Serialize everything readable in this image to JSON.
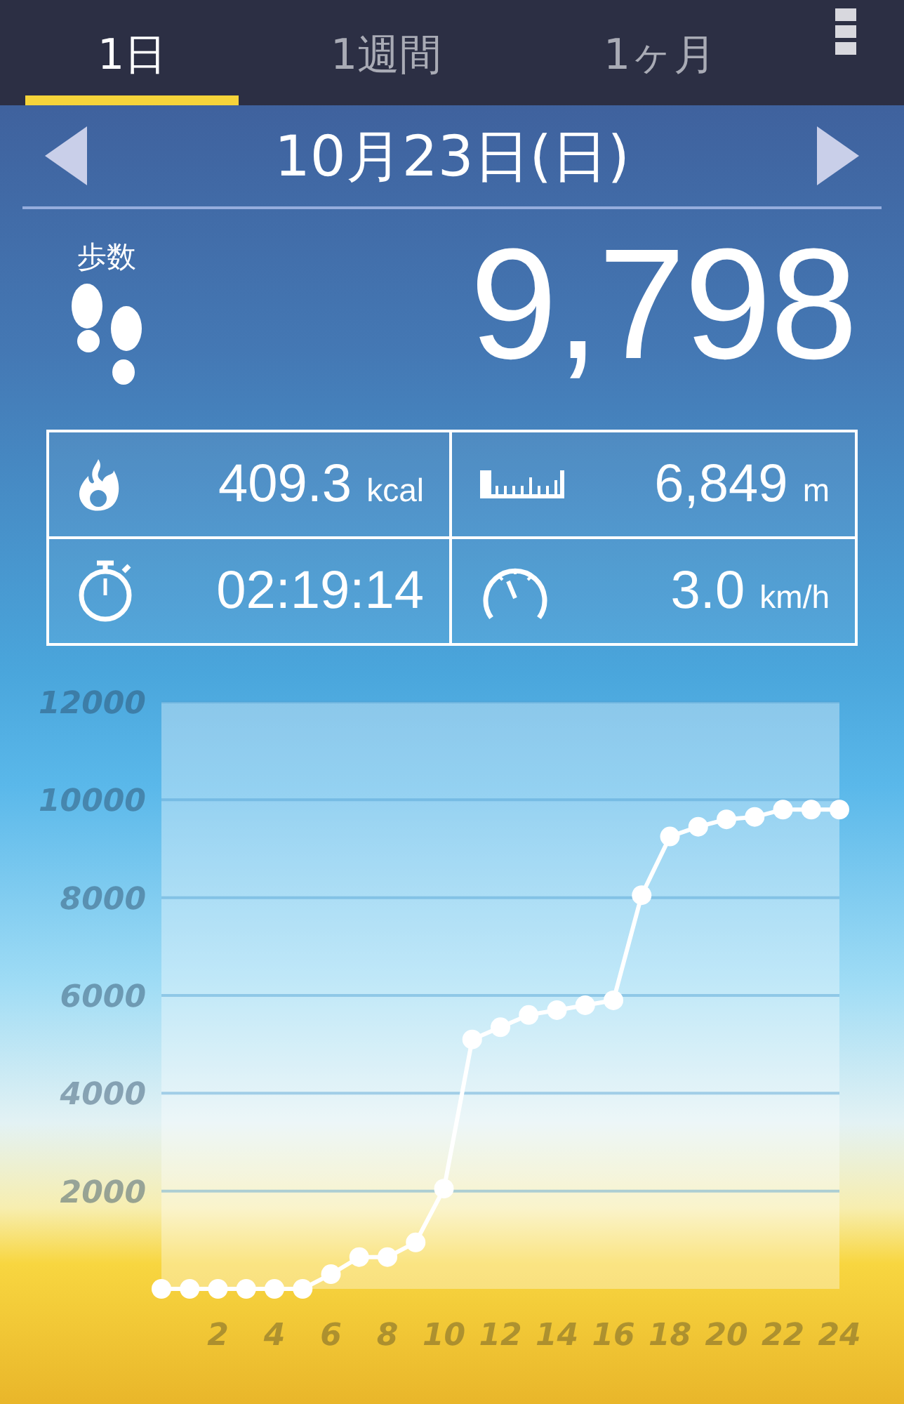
{
  "tabs": [
    {
      "label": "1日",
      "selected": true
    },
    {
      "label": "1週間",
      "selected": false
    },
    {
      "label": "1ヶ月",
      "selected": false
    }
  ],
  "date": "10月23日(日)",
  "steps": {
    "label": "歩数",
    "value": "9,798"
  },
  "stats": [
    {
      "kind": "calories",
      "value": "409.3",
      "unit": "kcal"
    },
    {
      "kind": "distance",
      "value": "6,849",
      "unit": "m"
    },
    {
      "kind": "time",
      "value": "02:19:14"
    },
    {
      "kind": "speed",
      "value": "3.0",
      "unit": "km/h"
    }
  ],
  "chart_data": {
    "type": "line",
    "x": [
      0,
      1,
      2,
      3,
      4,
      5,
      6,
      7,
      8,
      9,
      10,
      11,
      12,
      13,
      14,
      15,
      16,
      17,
      18,
      19,
      20,
      21,
      22,
      23,
      24
    ],
    "grid": true,
    "series": [
      {
        "color": "#ffffff",
        "marker": "circle",
        "values": [
          0,
          0,
          0,
          0,
          0,
          0,
          300,
          650,
          650,
          950,
          2050,
          5100,
          5350,
          5600,
          5700,
          5800,
          5900,
          8050,
          9250,
          9450,
          9600,
          9650,
          9800,
          9800,
          9800
        ]
      }
    ],
    "xlim": [
      0,
      24
    ],
    "ylim": [
      0,
      12000
    ],
    "xticks": [
      2,
      4,
      6,
      8,
      10,
      12,
      14,
      16,
      18,
      20,
      22,
      24
    ],
    "yticks": [
      2000,
      4000,
      6000,
      8000,
      10000,
      12000
    ]
  }
}
